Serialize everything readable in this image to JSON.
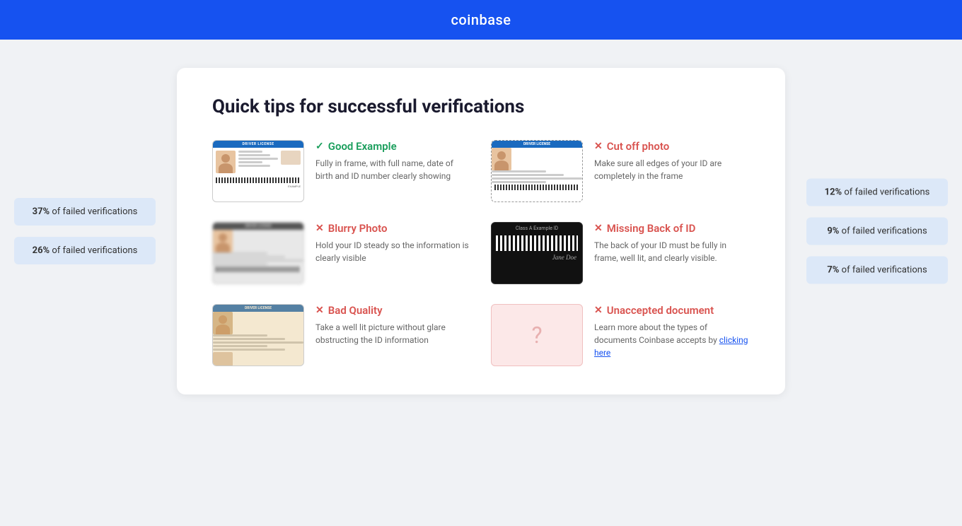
{
  "header": {
    "logo": "coinbase"
  },
  "page": {
    "title": "Quick tips for successful verifications"
  },
  "left_badges": [
    {
      "percentage": "37%",
      "label": "of failed verifications"
    },
    {
      "percentage": "26%",
      "label": "of failed verifications"
    }
  ],
  "right_badges": [
    {
      "percentage": "12%",
      "label": "of failed verifications"
    },
    {
      "percentage": "9%",
      "label": "of failed verifications"
    },
    {
      "percentage": "7%",
      "label": "of failed verifications"
    }
  ],
  "examples": [
    {
      "id": "good-example",
      "icon": "check",
      "title": "Good Example",
      "title_class": "good",
      "description": "Fully in frame, with full name, date of birth and ID number clearly showing",
      "card_type": "good"
    },
    {
      "id": "cut-off-photo",
      "icon": "x",
      "title": "Cut off photo",
      "title_class": "bad",
      "description": "Make sure all edges of your ID are completely in the frame",
      "card_type": "cutoff"
    },
    {
      "id": "blurry-photo",
      "icon": "x",
      "title": "Blurry Photo",
      "title_class": "bad",
      "description": "Hold your ID steady so the information is clearly visible",
      "card_type": "blurry"
    },
    {
      "id": "missing-back",
      "icon": "x",
      "title": "Missing Back of ID",
      "title_class": "bad",
      "description": "The back of your ID must be fully in frame, well lit, and clearly visible.",
      "card_type": "missing-back"
    },
    {
      "id": "bad-quality",
      "icon": "x",
      "title": "Bad Quality",
      "title_class": "bad",
      "description": "Take a well lit picture without glare obstructing the ID information",
      "card_type": "bad"
    },
    {
      "id": "unaccepted-document",
      "icon": "x",
      "title": "Unaccepted document",
      "title_class": "bad",
      "description": "Learn more about the types of documents Coinbase accepts by ",
      "link_text": "clicking here",
      "card_type": "unaccepted"
    }
  ]
}
